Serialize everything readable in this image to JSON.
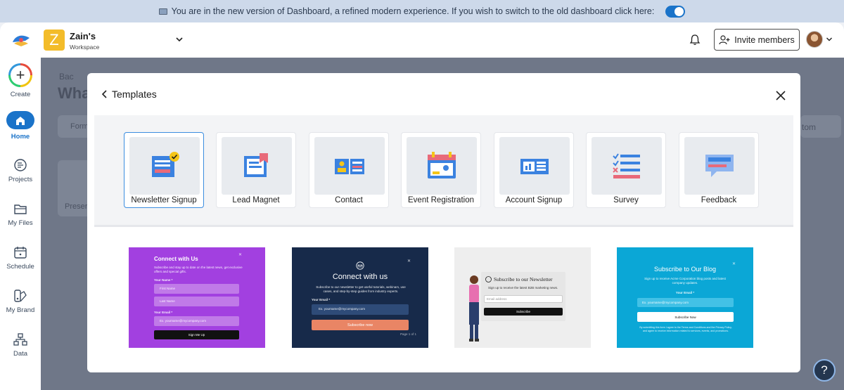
{
  "banner": {
    "text": "You are in the new version of Dashboard, a refined modern experience. If you wish to switch to the old dashboard click here:",
    "toggle_on": true
  },
  "header": {
    "workspace_initial": "Z",
    "workspace_name": "Zain's",
    "workspace_sub": "Workspace",
    "invite_label": "Invite members"
  },
  "sidebar": {
    "items": [
      {
        "label": "Create"
      },
      {
        "label": "Home"
      },
      {
        "label": "Projects"
      },
      {
        "label": "My Files"
      },
      {
        "label": "Schedule"
      },
      {
        "label": "My Brand"
      },
      {
        "label": "Data"
      }
    ]
  },
  "background": {
    "back": "Bac",
    "heading": "Wha",
    "chip": "Form",
    "right_chip": "tom",
    "tile": "Preser"
  },
  "modal": {
    "title": "Templates",
    "categories": [
      {
        "label": "Newsletter Signup",
        "icon": "newsletter-icon",
        "selected": true
      },
      {
        "label": "Lead Magnet",
        "icon": "lead-magnet-icon",
        "selected": false
      },
      {
        "label": "Contact",
        "icon": "contact-icon",
        "selected": false
      },
      {
        "label": "Event Registration",
        "icon": "calendar-icon",
        "selected": false
      },
      {
        "label": "Account Signup",
        "icon": "account-icon",
        "selected": false
      },
      {
        "label": "Survey",
        "icon": "survey-icon",
        "selected": false
      },
      {
        "label": "Feedback",
        "icon": "feedback-icon",
        "selected": false
      }
    ],
    "previews": [
      {
        "title": "Connect with Us",
        "desc": "Subscribe and stay up to date on the latest news, get exclusive offers and special gifts.",
        "name_label": "Your Name *",
        "first": "First Name",
        "last": "Last Name",
        "email_label": "Your Email *",
        "email": "Ex. yourname@mycompany.com",
        "button": "Sign Me Up"
      },
      {
        "title": "Connect with us",
        "desc": "Subscribe to our newsletter to get useful tutorials, webinars, use cases, and step-by-step guides from industry experts.",
        "email_label": "Your Email *",
        "email": "Ex. yourname@mycompany.com",
        "button": "Subscribe now",
        "page": "Page 1 of 1"
      },
      {
        "title": "Subscribe to our Newsletter",
        "desc": "Sign up to receive the latest B2B marketing news.",
        "email": "Email address",
        "button": "Subscribe"
      },
      {
        "title": "Subscribe to Our Blog",
        "desc": "Sign up to receive Acme Corporation blog posts and latest company updates.",
        "email_label": "Your Email *",
        "email": "Ex. yourname@mycompany.com",
        "button": "Subscribe Now",
        "legal": "By submitting this form I agree to the Terms and Conditions and the Privacy Policy, and agree to receive information related to services, events, and promotions."
      }
    ]
  },
  "colors": {
    "accent": "#1a73c9",
    "overlay": "#6f7788",
    "workspace_tile": "#f3bc2a"
  }
}
